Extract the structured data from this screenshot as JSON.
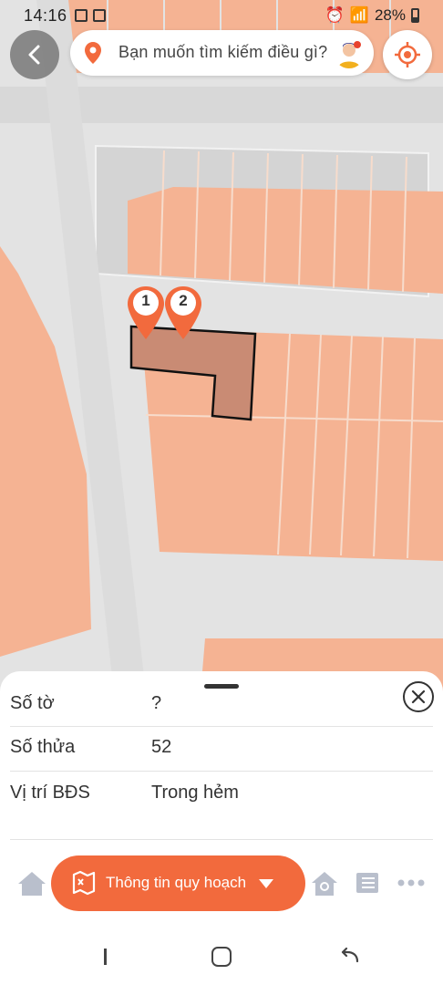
{
  "status_bar": {
    "time": "14:16",
    "battery": "28%"
  },
  "search": {
    "placeholder": "Bạn muốn tìm kiếm điều gì?"
  },
  "map": {
    "markers": [
      {
        "label": "1"
      },
      {
        "label": "2"
      }
    ],
    "colors": {
      "land": "#f5b393",
      "land_light": "#f7bfa3",
      "road": "#e3e3e3",
      "parcel": "#c98b74",
      "marker": "#f26a3d"
    }
  },
  "sheet": {
    "rows": [
      {
        "label": "Số tờ",
        "value": "?"
      },
      {
        "label": "Số thửa",
        "value": "52"
      },
      {
        "label": "Vị trí BĐS",
        "value": "Trong hẻm"
      }
    ]
  },
  "bottom_nav": {
    "planning_label": "Thông tin quy hoạch"
  },
  "accent": "#f26a3d"
}
